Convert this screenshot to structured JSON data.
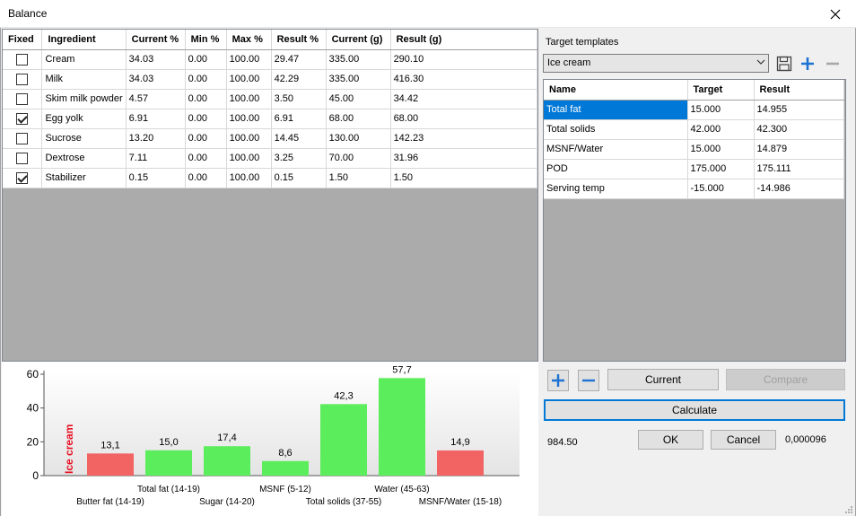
{
  "window": {
    "title": "Balance"
  },
  "ingredients": {
    "columns": [
      "Fixed",
      "Ingredient",
      "Current %",
      "Min %",
      "Max %",
      "Result %",
      "Current (g)",
      "Result (g)"
    ],
    "rows": [
      {
        "fixed": false,
        "name": "Cream",
        "current_pct": "34.03",
        "min_pct": "0.00",
        "max_pct": "100.00",
        "result_pct": "29.47",
        "current_g": "335.00",
        "result_g": "290.10"
      },
      {
        "fixed": false,
        "name": "Milk",
        "current_pct": "34.03",
        "min_pct": "0.00",
        "max_pct": "100.00",
        "result_pct": "42.29",
        "current_g": "335.00",
        "result_g": "416.30"
      },
      {
        "fixed": false,
        "name": "Skim milk powder",
        "current_pct": "4.57",
        "min_pct": "0.00",
        "max_pct": "100.00",
        "result_pct": "3.50",
        "current_g": "45.00",
        "result_g": "34.42"
      },
      {
        "fixed": true,
        "name": "Egg yolk",
        "current_pct": "6.91",
        "min_pct": "0.00",
        "max_pct": "100.00",
        "result_pct": "6.91",
        "current_g": "68.00",
        "result_g": "68.00"
      },
      {
        "fixed": false,
        "name": "Sucrose",
        "current_pct": "13.20",
        "min_pct": "0.00",
        "max_pct": "100.00",
        "result_pct": "14.45",
        "current_g": "130.00",
        "result_g": "142.23"
      },
      {
        "fixed": false,
        "name": "Dextrose",
        "current_pct": "7.11",
        "min_pct": "0.00",
        "max_pct": "100.00",
        "result_pct": "3.25",
        "current_g": "70.00",
        "result_g": "31.96"
      },
      {
        "fixed": true,
        "name": "Stabilizer",
        "current_pct": "0.15",
        "min_pct": "0.00",
        "max_pct": "100.00",
        "result_pct": "0.15",
        "current_g": "1.50",
        "result_g": "1.50"
      }
    ]
  },
  "target_templates": {
    "label": "Target templates",
    "selected": "Ice cream",
    "columns": [
      "Name",
      "Target",
      "Result"
    ],
    "rows": [
      {
        "name": "Total fat",
        "target": "15.000",
        "result": "14.955"
      },
      {
        "name": "Total solids",
        "target": "42.000",
        "result": "42.300"
      },
      {
        "name": "MSNF/Water",
        "target": "15.000",
        "result": "14.879"
      },
      {
        "name": "POD",
        "target": "175.000",
        "result": "175.111"
      },
      {
        "name": "Serving temp",
        "target": "-15.000",
        "result": "-14.986"
      }
    ],
    "selected_row": 0
  },
  "buttons": {
    "current": "Current",
    "compare": "Compare",
    "calculate": "Calculate",
    "ok": "OK",
    "cancel": "Cancel"
  },
  "status": {
    "total": "984.50",
    "deviation": "0,000096"
  },
  "colors": {
    "ok": "#5ced5c",
    "bad": "#f26464",
    "selection": "#0078d7",
    "title_red": "#e81123"
  },
  "chart_data": {
    "type": "bar",
    "title": "Ice cream",
    "ylim": [
      0,
      60
    ],
    "yticks": [
      0,
      20,
      40,
      60
    ],
    "categories": [
      "Butter fat (14-19)",
      "Total fat (14-19)",
      "Sugar (14-20)",
      "MSNF (5-12)",
      "Total solids (37-55)",
      "Water (45-63)",
      "MSNF/Water (15-18)"
    ],
    "values": [
      13.1,
      15.0,
      17.4,
      8.6,
      42.3,
      57.7,
      14.9
    ],
    "value_labels": [
      "13,1",
      "15,0",
      "17,4",
      "8,6",
      "42,3",
      "57,7",
      "14,9"
    ],
    "in_range": [
      false,
      true,
      true,
      true,
      true,
      true,
      false
    ]
  }
}
